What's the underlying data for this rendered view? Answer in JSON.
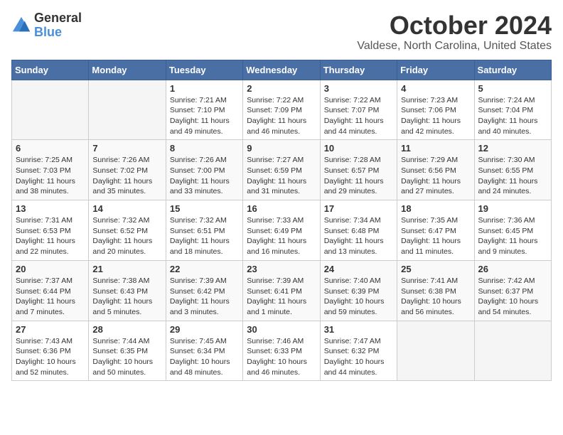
{
  "logo": {
    "general": "General",
    "blue": "Blue"
  },
  "title": "October 2024",
  "location": "Valdese, North Carolina, United States",
  "weekdays": [
    "Sunday",
    "Monday",
    "Tuesday",
    "Wednesday",
    "Thursday",
    "Friday",
    "Saturday"
  ],
  "weeks": [
    [
      {
        "day": "",
        "info": ""
      },
      {
        "day": "",
        "info": ""
      },
      {
        "day": "1",
        "info": "Sunrise: 7:21 AM\nSunset: 7:10 PM\nDaylight: 11 hours and 49 minutes."
      },
      {
        "day": "2",
        "info": "Sunrise: 7:22 AM\nSunset: 7:09 PM\nDaylight: 11 hours and 46 minutes."
      },
      {
        "day": "3",
        "info": "Sunrise: 7:22 AM\nSunset: 7:07 PM\nDaylight: 11 hours and 44 minutes."
      },
      {
        "day": "4",
        "info": "Sunrise: 7:23 AM\nSunset: 7:06 PM\nDaylight: 11 hours and 42 minutes."
      },
      {
        "day": "5",
        "info": "Sunrise: 7:24 AM\nSunset: 7:04 PM\nDaylight: 11 hours and 40 minutes."
      }
    ],
    [
      {
        "day": "6",
        "info": "Sunrise: 7:25 AM\nSunset: 7:03 PM\nDaylight: 11 hours and 38 minutes."
      },
      {
        "day": "7",
        "info": "Sunrise: 7:26 AM\nSunset: 7:02 PM\nDaylight: 11 hours and 35 minutes."
      },
      {
        "day": "8",
        "info": "Sunrise: 7:26 AM\nSunset: 7:00 PM\nDaylight: 11 hours and 33 minutes."
      },
      {
        "day": "9",
        "info": "Sunrise: 7:27 AM\nSunset: 6:59 PM\nDaylight: 11 hours and 31 minutes."
      },
      {
        "day": "10",
        "info": "Sunrise: 7:28 AM\nSunset: 6:57 PM\nDaylight: 11 hours and 29 minutes."
      },
      {
        "day": "11",
        "info": "Sunrise: 7:29 AM\nSunset: 6:56 PM\nDaylight: 11 hours and 27 minutes."
      },
      {
        "day": "12",
        "info": "Sunrise: 7:30 AM\nSunset: 6:55 PM\nDaylight: 11 hours and 24 minutes."
      }
    ],
    [
      {
        "day": "13",
        "info": "Sunrise: 7:31 AM\nSunset: 6:53 PM\nDaylight: 11 hours and 22 minutes."
      },
      {
        "day": "14",
        "info": "Sunrise: 7:32 AM\nSunset: 6:52 PM\nDaylight: 11 hours and 20 minutes."
      },
      {
        "day": "15",
        "info": "Sunrise: 7:32 AM\nSunset: 6:51 PM\nDaylight: 11 hours and 18 minutes."
      },
      {
        "day": "16",
        "info": "Sunrise: 7:33 AM\nSunset: 6:49 PM\nDaylight: 11 hours and 16 minutes."
      },
      {
        "day": "17",
        "info": "Sunrise: 7:34 AM\nSunset: 6:48 PM\nDaylight: 11 hours and 13 minutes."
      },
      {
        "day": "18",
        "info": "Sunrise: 7:35 AM\nSunset: 6:47 PM\nDaylight: 11 hours and 11 minutes."
      },
      {
        "day": "19",
        "info": "Sunrise: 7:36 AM\nSunset: 6:45 PM\nDaylight: 11 hours and 9 minutes."
      }
    ],
    [
      {
        "day": "20",
        "info": "Sunrise: 7:37 AM\nSunset: 6:44 PM\nDaylight: 11 hours and 7 minutes."
      },
      {
        "day": "21",
        "info": "Sunrise: 7:38 AM\nSunset: 6:43 PM\nDaylight: 11 hours and 5 minutes."
      },
      {
        "day": "22",
        "info": "Sunrise: 7:39 AM\nSunset: 6:42 PM\nDaylight: 11 hours and 3 minutes."
      },
      {
        "day": "23",
        "info": "Sunrise: 7:39 AM\nSunset: 6:41 PM\nDaylight: 11 hours and 1 minute."
      },
      {
        "day": "24",
        "info": "Sunrise: 7:40 AM\nSunset: 6:39 PM\nDaylight: 10 hours and 59 minutes."
      },
      {
        "day": "25",
        "info": "Sunrise: 7:41 AM\nSunset: 6:38 PM\nDaylight: 10 hours and 56 minutes."
      },
      {
        "day": "26",
        "info": "Sunrise: 7:42 AM\nSunset: 6:37 PM\nDaylight: 10 hours and 54 minutes."
      }
    ],
    [
      {
        "day": "27",
        "info": "Sunrise: 7:43 AM\nSunset: 6:36 PM\nDaylight: 10 hours and 52 minutes."
      },
      {
        "day": "28",
        "info": "Sunrise: 7:44 AM\nSunset: 6:35 PM\nDaylight: 10 hours and 50 minutes."
      },
      {
        "day": "29",
        "info": "Sunrise: 7:45 AM\nSunset: 6:34 PM\nDaylight: 10 hours and 48 minutes."
      },
      {
        "day": "30",
        "info": "Sunrise: 7:46 AM\nSunset: 6:33 PM\nDaylight: 10 hours and 46 minutes."
      },
      {
        "day": "31",
        "info": "Sunrise: 7:47 AM\nSunset: 6:32 PM\nDaylight: 10 hours and 44 minutes."
      },
      {
        "day": "",
        "info": ""
      },
      {
        "day": "",
        "info": ""
      }
    ]
  ]
}
